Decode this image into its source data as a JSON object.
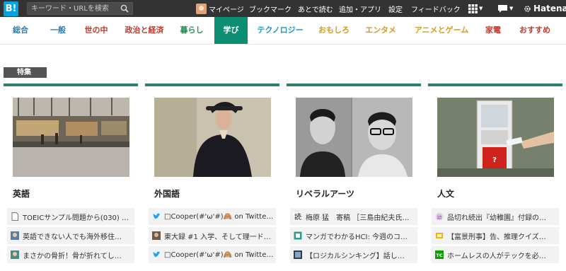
{
  "topbar": {
    "logo": "B!",
    "search_placeholder": "キーワード・URLを検索",
    "menu": {
      "mypage": "マイページ",
      "bookmark": "ブックマーク",
      "read_later": "あとで読む",
      "addons": "追加・アプリ",
      "settings": "設定",
      "feedback": "フィードバック"
    },
    "brand": "Hatena"
  },
  "categories": [
    {
      "label": "総合",
      "color": "#2c7bb0"
    },
    {
      "label": "一般",
      "color": "#2c7bb0"
    },
    {
      "label": "世の中",
      "color": "#c0392b"
    },
    {
      "label": "政治と経済",
      "color": "#c0392b"
    },
    {
      "label": "暮らし",
      "color": "#2e8b57"
    },
    {
      "label": "学び",
      "color": "#ffffff"
    },
    {
      "label": "テクノロジー",
      "color": "#1d97c9"
    },
    {
      "label": "おもしろ",
      "color": "#d39c1c"
    },
    {
      "label": "エンタメ",
      "color": "#d39c1c"
    },
    {
      "label": "アニメとゲーム",
      "color": "#d39c1c"
    },
    {
      "label": "家電",
      "color": "#c0392b"
    },
    {
      "label": "おすすめ",
      "color": "#c0392b"
    }
  ],
  "active_category": "学び",
  "section": {
    "label": "特集"
  },
  "cards": [
    {
      "title": "英語",
      "thumb": "street-scene",
      "items": [
        {
          "icon": "document-icon",
          "text": "TOEICサンプル問題から(030) …"
        },
        {
          "icon": "face-icon",
          "text": "英語できない人でも海外移住…"
        },
        {
          "icon": "face-icon",
          "text": "まさかの骨折！骨が折れてし…"
        }
      ]
    },
    {
      "title": "外国語",
      "thumb": "portrait-painting",
      "items": [
        {
          "icon": "twitter-icon",
          "text": "□Cooper(#'ω'#)🙈 on Twitter: \"…"
        },
        {
          "icon": "photo-icon",
          "text": "東大録 #1 入学、そして理一ド…"
        },
        {
          "icon": "twitter-icon",
          "text": "□Cooper(#'ω'#)🙈 on Twitter: \"…"
        }
      ]
    },
    {
      "title": "リベラルアーツ",
      "thumb": "two-men-photo",
      "items": [
        {
          "icon": "kanji-icon",
          "text": "梅原 猛　寄稿 ［三島由紀夫氏…"
        },
        {
          "icon": "square-icon",
          "text": "マンガでわかるHCI: 今週のコ…"
        },
        {
          "icon": "photo-icon",
          "text": "【ロジカルシンキング】話し…"
        }
      ]
    },
    {
      "title": "人文",
      "thumb": "vending-machine",
      "items": [
        {
          "icon": "purple-icon",
          "text": "品切れ続出『幼稚園』付録の…"
        },
        {
          "icon": "orange-icon",
          "text": "【富景刑事】告、推理クイズ…"
        },
        {
          "icon": "tc-icon",
          "text": "ホームレスの人がテックを必…"
        }
      ]
    }
  ]
}
